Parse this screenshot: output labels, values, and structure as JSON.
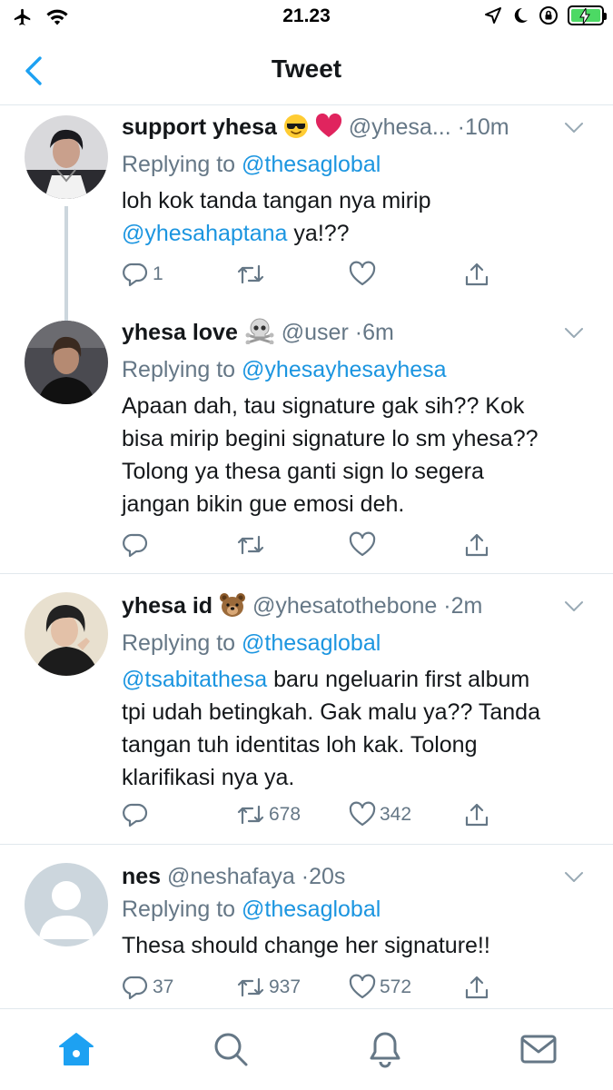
{
  "status_bar": {
    "time": "21.23",
    "icons": [
      "airplane-icon",
      "wifi-icon",
      "location-icon",
      "moon-icon",
      "orientation-lock-icon",
      "battery-charging-icon"
    ]
  },
  "header": {
    "title": "Tweet",
    "back_icon": "chevron-left-icon"
  },
  "colors": {
    "accent": "#1da1f2",
    "mention": "#1b95e0",
    "muted": "#657786",
    "divider": "#e1e8ed",
    "battery": "#4cd964"
  },
  "tweets": [
    {
      "display_name": "support yhesa",
      "emojis": [
        "sunglasses-emoji",
        "red-heart-emoji"
      ],
      "handle": "@yhesa...",
      "sep": "·",
      "time": "10m",
      "replying_prefix": "Replying to",
      "replying_to": "@thesaglobal",
      "text_lines": [
        [
          {
            "t": "loh kok tanda tangan nya mirip",
            "m": false
          }
        ],
        [
          {
            "t": "@yhesahaptana",
            "m": true
          },
          {
            "t": " ya!??",
            "m": false
          }
        ]
      ],
      "counts": {
        "reply": "1",
        "retweet": "",
        "like": ""
      }
    },
    {
      "display_name": "yhesa love",
      "emojis": [
        "skull-crossbones-emoji"
      ],
      "handle": "@user",
      "sep": "·",
      "time": "6m",
      "replying_prefix": "Replying to",
      "replying_to": "@yhesayhesayhesa",
      "text_lines": [
        [
          {
            "t": "Apaan dah, tau signature gak sih?? Kok",
            "m": false
          }
        ],
        [
          {
            "t": "bisa mirip begini signature lo sm yhesa??",
            "m": false
          }
        ],
        [
          {
            "t": "Tolong ya thesa ganti sign lo segera",
            "m": false
          }
        ],
        [
          {
            "t": "jangan bikin gue emosi deh.",
            "m": false
          }
        ]
      ],
      "counts": {
        "reply": "",
        "retweet": "",
        "like": ""
      }
    },
    {
      "display_name": "yhesa id",
      "emojis": [
        "bear-emoji"
      ],
      "handle": "@yhesatothebone",
      "sep": "·",
      "time": "2m",
      "replying_prefix": "Replying to",
      "replying_to": "@thesaglobal",
      "text_lines": [
        [
          {
            "t": "@tsabitathesa",
            "m": true
          },
          {
            "t": " baru ngeluarin first album",
            "m": false
          }
        ],
        [
          {
            "t": "tpi udah betingkah. Gak malu ya?? Tanda",
            "m": false
          }
        ],
        [
          {
            "t": "tangan tuh identitas loh kak. Tolong",
            "m": false
          }
        ],
        [
          {
            "t": "klarifikasi nya ya.",
            "m": false
          }
        ]
      ],
      "counts": {
        "reply": "",
        "retweet": "678",
        "like": "342"
      }
    },
    {
      "display_name": "nes",
      "emojis": [],
      "handle": "@neshafaya",
      "sep": "·",
      "time": "20s",
      "replying_prefix": "Replying to",
      "replying_to": "@thesaglobal",
      "text_lines": [
        [
          {
            "t": "Thesa should change her signature!!",
            "m": false
          }
        ]
      ],
      "counts": {
        "reply": "37",
        "retweet": "937",
        "like": "572"
      }
    }
  ],
  "tab_bar": {
    "items": [
      "home-icon",
      "search-icon",
      "notifications-icon",
      "messages-icon"
    ],
    "active": "home-icon"
  }
}
